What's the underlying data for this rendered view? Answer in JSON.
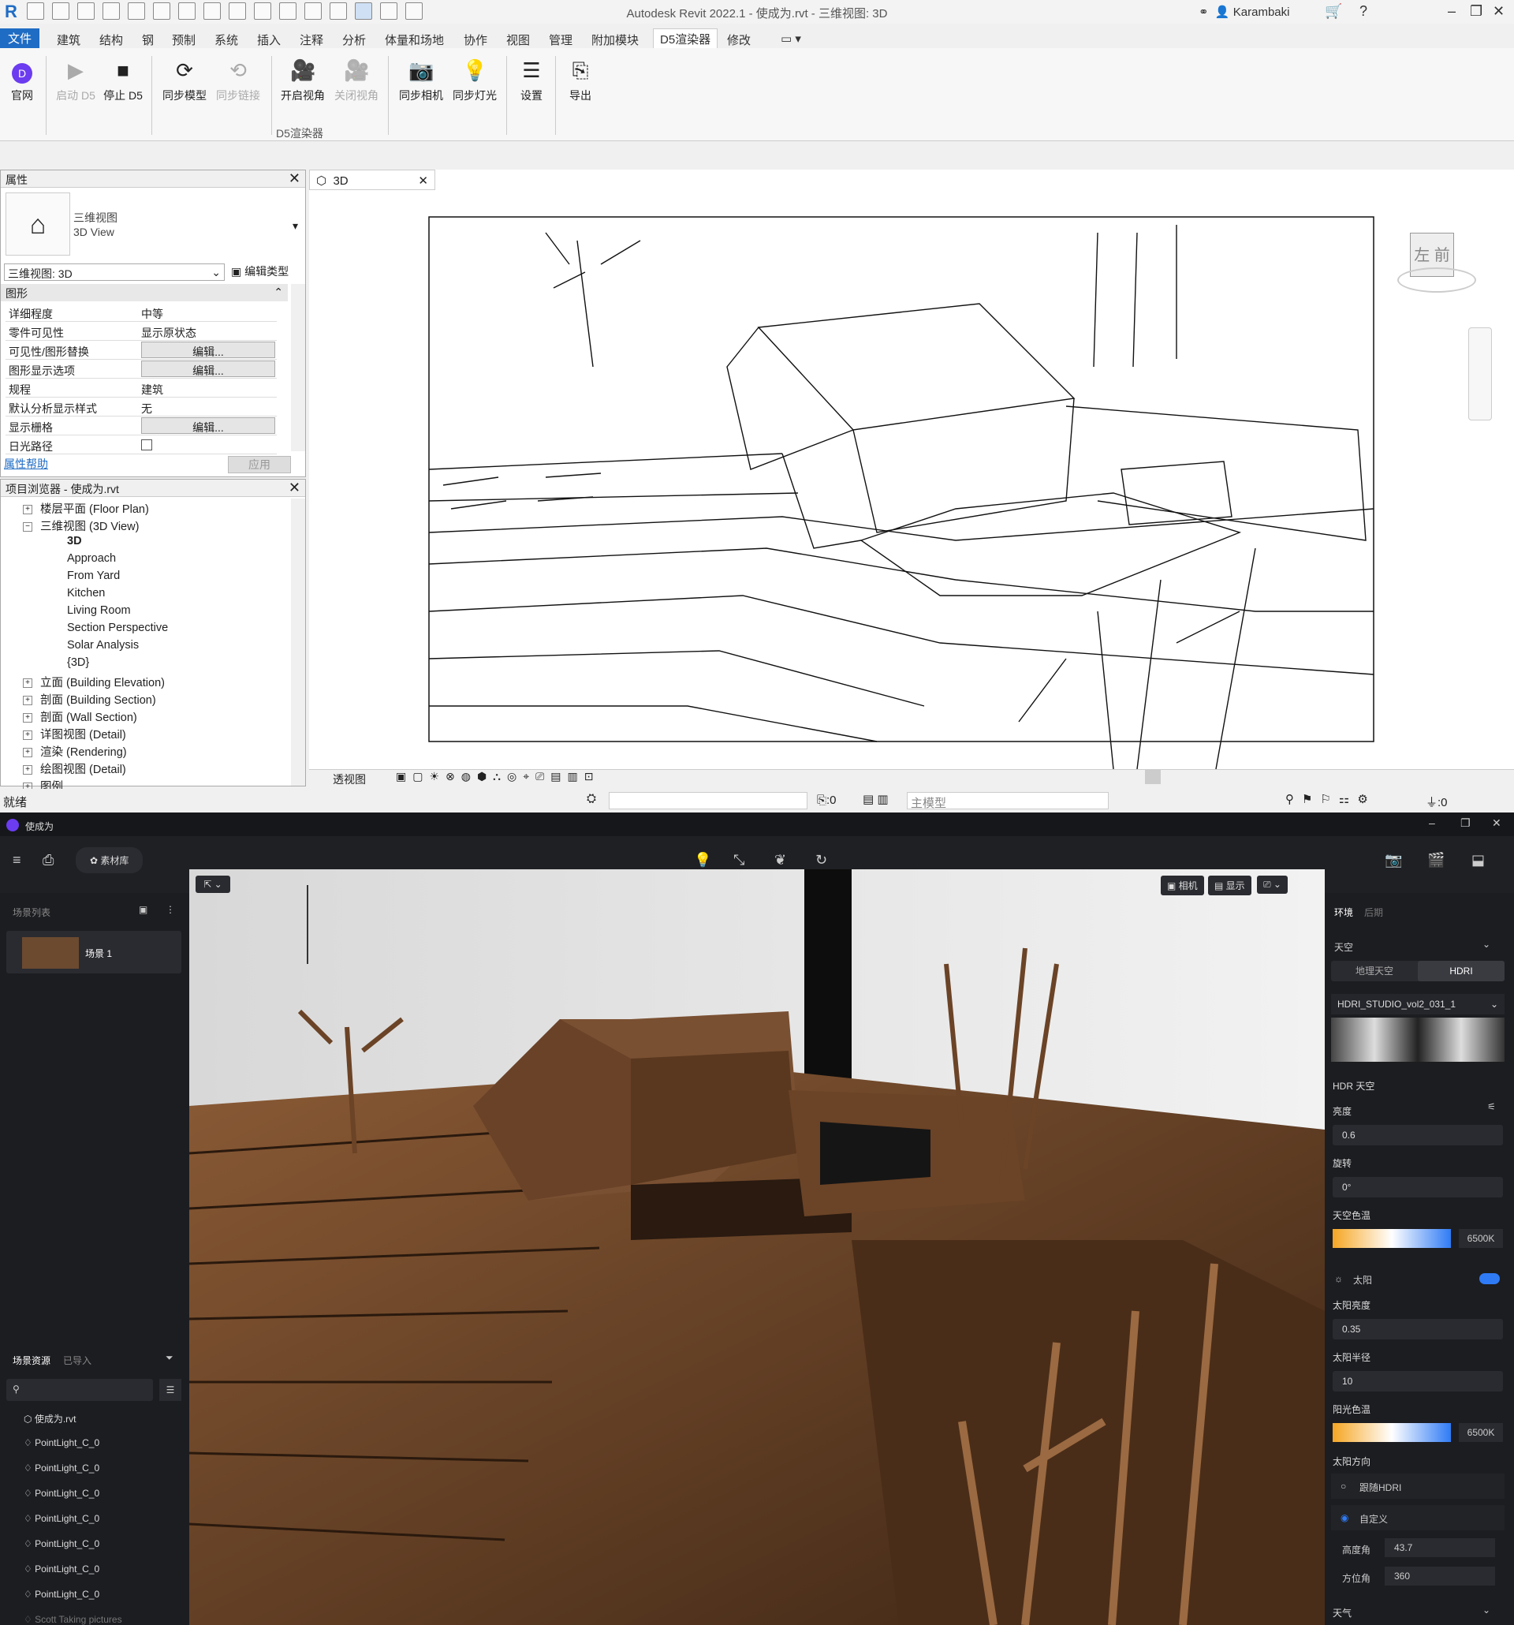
{
  "revit": {
    "title": "Autodesk Revit 2022.1 - 使成为.rvt - 三维视图: 3D",
    "user": "Karambaki",
    "menu": [
      "文件",
      "建筑",
      "结构",
      "钢",
      "预制",
      "系统",
      "插入",
      "注释",
      "分析",
      "体量和场地",
      "协作",
      "视图",
      "管理",
      "附加模块",
      "D5渲染器",
      "修改"
    ],
    "ribbon": [
      {
        "label": "官网",
        "icon": "d5-logo-icon",
        "disabled": false
      },
      {
        "label": "启动 D5",
        "icon": "play-icon",
        "disabled": true
      },
      {
        "label": "停止 D5",
        "icon": "stop-icon",
        "disabled": false
      },
      {
        "label": "同步模型",
        "icon": "sync-icon",
        "disabled": false
      },
      {
        "label": "同步链接",
        "icon": "sync-link-icon",
        "disabled": true
      },
      {
        "label": "开启视角",
        "icon": "camera-on-icon",
        "disabled": false
      },
      {
        "label": "关闭视角",
        "icon": "camera-off-icon",
        "disabled": true
      },
      {
        "label": "同步相机",
        "icon": "sync-camera-icon",
        "disabled": false
      },
      {
        "label": "同步灯光",
        "icon": "sync-light-icon",
        "disabled": false
      },
      {
        "label": "设置",
        "icon": "settings-icon",
        "disabled": false
      },
      {
        "label": "导出",
        "icon": "export-icon",
        "disabled": false
      }
    ],
    "ribbon_group": "D5渲染器",
    "properties": {
      "title": "属性",
      "type_cn": "三维视图",
      "type_en": "3D View",
      "selector": "三维视图: 3D",
      "edit_type": "编辑类型",
      "section": "图形",
      "rows": [
        {
          "k": "详细程度",
          "v": "中等",
          "btn": false
        },
        {
          "k": "零件可见性",
          "v": "显示原状态",
          "btn": false
        },
        {
          "k": "可见性/图形替换",
          "v": "编辑...",
          "btn": true
        },
        {
          "k": "图形显示选项",
          "v": "编辑...",
          "btn": true
        },
        {
          "k": "规程",
          "v": "建筑",
          "btn": false
        },
        {
          "k": "默认分析显示样式",
          "v": "无",
          "btn": false
        },
        {
          "k": "显示栅格",
          "v": "编辑...",
          "btn": true
        },
        {
          "k": "日光路径",
          "v": "",
          "btn": false
        }
      ],
      "help": "属性帮助",
      "apply": "应用"
    },
    "browser": {
      "title": "项目浏览器 - 使成为.rvt",
      "items": [
        {
          "t": "楼层平面 (Floor Plan)",
          "lvl": 1,
          "exp": "+"
        },
        {
          "t": "三维视图 (3D View)",
          "lvl": 1,
          "exp": "-"
        },
        {
          "t": "3D",
          "lvl": 2,
          "exp": ""
        },
        {
          "t": "Approach",
          "lvl": 2,
          "exp": ""
        },
        {
          "t": "From Yard",
          "lvl": 2,
          "exp": ""
        },
        {
          "t": "Kitchen",
          "lvl": 2,
          "exp": ""
        },
        {
          "t": "Living Room",
          "lvl": 2,
          "exp": ""
        },
        {
          "t": "Section Perspective",
          "lvl": 2,
          "exp": ""
        },
        {
          "t": "Solar Analysis",
          "lvl": 2,
          "exp": ""
        },
        {
          "t": "{3D}",
          "lvl": 2,
          "exp": ""
        },
        {
          "t": "立面 (Building Elevation)",
          "lvl": 1,
          "exp": "+"
        },
        {
          "t": "剖面 (Building Section)",
          "lvl": 1,
          "exp": "+"
        },
        {
          "t": "剖面 (Wall Section)",
          "lvl": 1,
          "exp": "+"
        },
        {
          "t": "详图视图 (Detail)",
          "lvl": 1,
          "exp": "+"
        },
        {
          "t": "渲染 (Rendering)",
          "lvl": 1,
          "exp": "+"
        },
        {
          "t": "绘图视图 (Detail)",
          "lvl": 1,
          "exp": "+"
        },
        {
          "t": "图例",
          "lvl": 1,
          "exp": "+"
        }
      ]
    },
    "view_tab": "3D",
    "viewcube": {
      "left": "左",
      "front": "前"
    },
    "view_mode": "透视图",
    "status": "就绪",
    "status_zero": ":0",
    "model": "主模型",
    "filter_zero": ":0"
  },
  "d5": {
    "app_title": "使成为",
    "library": "素材库",
    "scene_list": "场景列表",
    "scene1": "场景 1",
    "assets_tab": "场景资源",
    "imported_tab": "已导入",
    "assets": [
      "使成为.rvt",
      "PointLight_C_0",
      "PointLight_C_0",
      "PointLight_C_0",
      "PointLight_C_0",
      "PointLight_C_0",
      "PointLight_C_0",
      "PointLight_C_0",
      "Scott Taking pictures"
    ],
    "viewport_btns": [
      "相机",
      "显示"
    ],
    "tabs": [
      "环境",
      "后期"
    ],
    "sky": "天空",
    "sky_tabs": [
      "地理天空",
      "HDRI"
    ],
    "hdri_name": "HDRI_STUDIO_vol2_031_1",
    "hdr_sky": "HDR 天空",
    "brightness_label": "亮度",
    "brightness": "0.6",
    "rotation_label": "旋转",
    "rotation": "0°",
    "sky_temp_label": "天空色温",
    "sky_temp": "6500K",
    "sun": "太阳",
    "sun_brightness_label": "太阳亮度",
    "sun_brightness": "0.35",
    "sun_radius_label": "太阳半径",
    "sun_radius": "10",
    "sunlight_temp_label": "阳光色温",
    "sunlight_temp": "6500K",
    "sun_dir_label": "太阳方向",
    "follow_hdri": "跟随HDRI",
    "custom": "自定义",
    "altitude_label": "高度角",
    "altitude": "43.7",
    "azimuth_label": "方位角",
    "azimuth": "360",
    "weather": "天气"
  }
}
